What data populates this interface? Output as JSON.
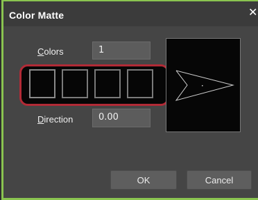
{
  "dialog": {
    "title": "Color Matte",
    "close_glyph": "✕"
  },
  "colors": {
    "label_accel": "C",
    "label_rest": "olors",
    "value": "1"
  },
  "swatches": [
    "#060606",
    "#060606",
    "#060606",
    "#060606"
  ],
  "direction": {
    "label_accel": "D",
    "label_rest": "irection",
    "value": "0.00"
  },
  "preview": {
    "background": "#060606",
    "arrow_icon": "direction-arrow-icon"
  },
  "buttons": {
    "ok": "OK",
    "cancel": "Cancel"
  },
  "theme": {
    "accent": "#8ac450",
    "highlight": "#b22a36"
  }
}
